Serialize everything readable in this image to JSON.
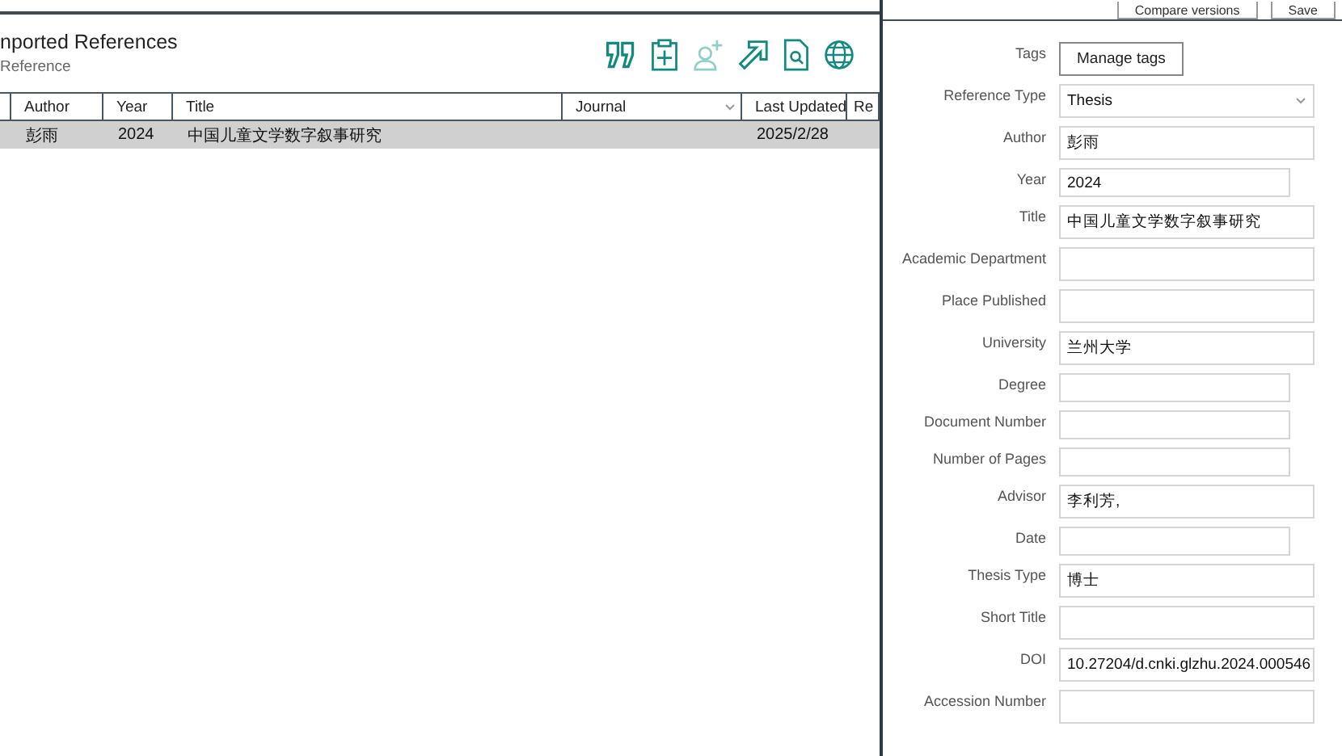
{
  "library": {
    "title": "nported References",
    "subtitle": "Reference"
  },
  "tools": [
    {
      "kind": "quote",
      "disabled": false
    },
    {
      "kind": "clipboard-add",
      "disabled": false
    },
    {
      "kind": "person-add",
      "disabled": true
    },
    {
      "kind": "arrow",
      "disabled": false
    },
    {
      "kind": "file-search",
      "disabled": false
    },
    {
      "kind": "globe",
      "disabled": false
    }
  ],
  "table": {
    "columns": [
      {
        "label": "Author",
        "menu": false
      },
      {
        "label": "Year",
        "menu": false
      },
      {
        "label": "Title",
        "menu": false
      },
      {
        "label": "Journal",
        "menu": true
      },
      {
        "label": "Last Updated",
        "menu": false
      },
      {
        "label": "Re",
        "menu": false
      }
    ],
    "rows": [
      {
        "selected": true,
        "author": "彭雨",
        "year": "2024",
        "title": "中国儿童文学数字叙事研究",
        "last_updated": "2025/2/28"
      }
    ]
  },
  "editor": {
    "buttons": [
      "Compare versions",
      "Save"
    ],
    "fields": [
      {
        "label": "Tags",
        "kind": "button",
        "value": "Manage tags"
      },
      {
        "label": "Reference Type",
        "kind": "select",
        "value": "Thesis"
      },
      {
        "label": "Author",
        "kind": "wide",
        "value": "彭雨"
      },
      {
        "label": "Year",
        "kind": "narrow",
        "value": "2024"
      },
      {
        "label": "Title",
        "kind": "wide",
        "value": "中国儿童文学数字叙事研究"
      },
      {
        "label": "Academic Department",
        "kind": "wide"
      },
      {
        "label": "Place Published",
        "kind": "wide"
      },
      {
        "label": "University",
        "kind": "wide",
        "value": "兰州大学"
      },
      {
        "label": "Degree",
        "kind": "narrow"
      },
      {
        "label": "Document Number",
        "kind": "narrow"
      },
      {
        "label": "Number of Pages",
        "kind": "narrow"
      },
      {
        "label": "Advisor",
        "kind": "wide",
        "value": "李利芳,"
      },
      {
        "label": "Date",
        "kind": "narrow"
      },
      {
        "label": "Thesis Type",
        "kind": "wide",
        "value": "博士"
      },
      {
        "label": "Short Title",
        "kind": "wide"
      },
      {
        "label": "DOI",
        "kind": "wide",
        "value": "10.27204/d.cnki.glzhu.2024.000546"
      },
      {
        "label": "Accession Number",
        "kind": "wide"
      }
    ]
  }
}
